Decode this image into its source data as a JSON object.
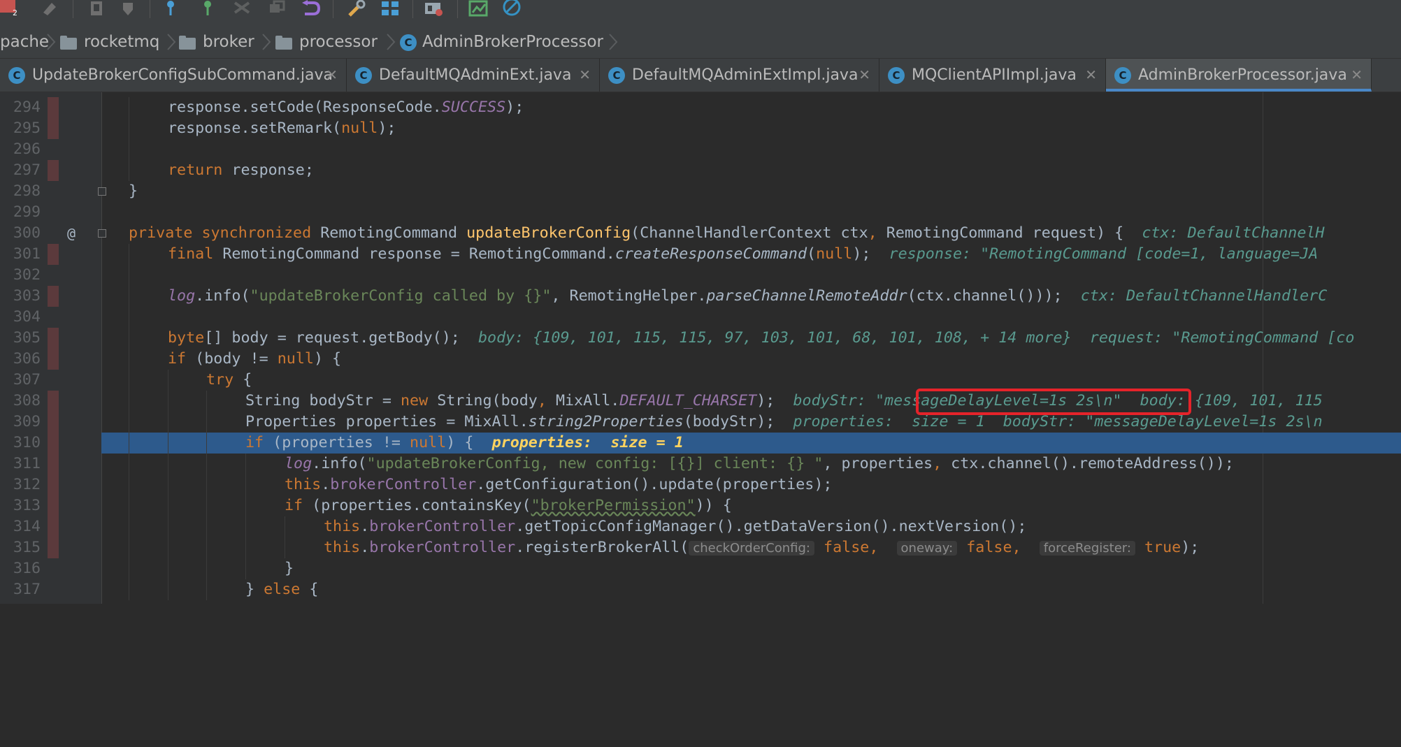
{
  "toolbar": {
    "icons": [
      "task-icon",
      "run-icon",
      "build-icon",
      "build-down-icon",
      "branch-icon",
      "merge-icon",
      "compare-icon",
      "stash-icon",
      "revert-icon",
      "settings-icon",
      "structure-icon",
      "sdk-icon",
      "coverage-icon",
      "no-entry-icon"
    ],
    "badge": "2"
  },
  "breadcrumb": {
    "items": [
      "pache",
      "rocketmq",
      "broker",
      "processor",
      "AdminBrokerProcessor"
    ],
    "class_badge": "C"
  },
  "tabs": [
    {
      "label": "UpdateBrokerConfigSubCommand.java",
      "active": false
    },
    {
      "label": "DefaultMQAdminExt.java",
      "active": false
    },
    {
      "label": "DefaultMQAdminExtImpl.java",
      "active": false
    },
    {
      "label": "MQClientAPIImpl.java",
      "active": false
    },
    {
      "label": "AdminBrokerProcessor.java",
      "active": true
    }
  ],
  "tab_close": "✕",
  "editor": {
    "current_line": 310,
    "highlighted_value": "\"messageDelayLevel=1s 2s\\n\"",
    "lines": [
      {
        "n": "294",
        "bp": true
      },
      {
        "n": "295",
        "bp": true
      },
      {
        "n": "296",
        "bp": false
      },
      {
        "n": "297",
        "bp": true
      },
      {
        "n": "298",
        "bp": false
      },
      {
        "n": "299",
        "bp": false
      },
      {
        "n": "300",
        "bp": false
      },
      {
        "n": "301",
        "bp": true
      },
      {
        "n": "302",
        "bp": false
      },
      {
        "n": "303",
        "bp": true
      },
      {
        "n": "304",
        "bp": false
      },
      {
        "n": "305",
        "bp": true
      },
      {
        "n": "306",
        "bp": true
      },
      {
        "n": "307",
        "bp": false
      },
      {
        "n": "308",
        "bp": true
      },
      {
        "n": "309",
        "bp": true
      },
      {
        "n": "310",
        "bp": true
      },
      {
        "n": "311",
        "bp": true
      },
      {
        "n": "312",
        "bp": true
      },
      {
        "n": "313",
        "bp": true
      },
      {
        "n": "314",
        "bp": true
      },
      {
        "n": "315",
        "bp": true
      },
      {
        "n": "316",
        "bp": false
      },
      {
        "n": "317",
        "bp": false
      }
    ],
    "tokens": {
      "l294": [
        "response",
        ".setCode(",
        "ResponseCode.",
        "SUCCESS",
        ");"
      ],
      "l295": [
        "response.setRemark(",
        "null",
        ");"
      ],
      "l297": [
        "return",
        " response;"
      ],
      "l298": [
        "}"
      ],
      "l300": [
        "private",
        " ",
        "synchronized",
        " RemotingCommand ",
        "updateBrokerConfig",
        "(ChannelHandlerContext ctx",
        ",",
        " RemotingCommand request) {  ",
        "ctx: DefaultChannelH"
      ],
      "l301": [
        "final",
        " RemotingCommand response = RemotingCommand.",
        "createResponseCommand",
        "(",
        "null",
        ");  ",
        "response: \"RemotingCommand [code=1, language=JA"
      ],
      "l303": [
        "log",
        ".info(",
        "\"updateBrokerConfig called by {}\"",
        ", RemotingHelper.",
        "parseChannelRemoteAddr",
        "(ctx.channel()));  ",
        "ctx: DefaultChannelHandlerC"
      ],
      "l305": [
        "byte",
        "[] body = request.getBody();  ",
        "body: {109, 101, 115, 115, 97, 103, 101, 68, 101, 108, + 14 more}  request: \"RemotingCommand [co"
      ],
      "l306": [
        "if",
        " (body != ",
        "null",
        ") {"
      ],
      "l307": [
        "try",
        " {"
      ],
      "l308": [
        "String bodyStr = ",
        "new",
        " String(body",
        ",",
        " MixAll.",
        "DEFAULT_CHARSET",
        ");  ",
        "bodyStr: ",
        "\"messageDelayLevel=1s 2s\\n\"",
        "  body: {109, 101, 115"
      ],
      "l309": [
        "Properties properties = MixAll.",
        "string2Properties",
        "(bodyStr);  ",
        "properties:  size = 1  bodyStr: \"messageDelayLevel=1s 2s\\n"
      ],
      "l310": [
        "if",
        " (properties != ",
        "null",
        ") {  ",
        "properties:  size = 1"
      ],
      "l311": [
        "log",
        ".info(",
        "\"updateBrokerConfig, new config: [{}] client: {} \"",
        ", properties",
        ",",
        " ctx.channel().remoteAddress());"
      ],
      "l312": [
        "this",
        ".",
        "brokerController",
        ".getConfiguration().update(properties);"
      ],
      "l313": [
        "if",
        " (properties.containsKey(",
        "\"brokerPermission\"",
        ")) {"
      ],
      "l314": [
        "this",
        ".",
        "brokerController",
        ".getTopicConfigManager().getDataVersion().nextVersion();"
      ],
      "l315": [
        "this",
        ".",
        "brokerController",
        ".registerBrokerAll(",
        "checkOrderConfig:",
        "false",
        ",",
        "oneway:",
        "false",
        ",",
        "forceRegister:",
        "true",
        ");"
      ],
      "l316": [
        "}"
      ],
      "l317": [
        "}",
        " ",
        "else",
        " {"
      ]
    }
  }
}
